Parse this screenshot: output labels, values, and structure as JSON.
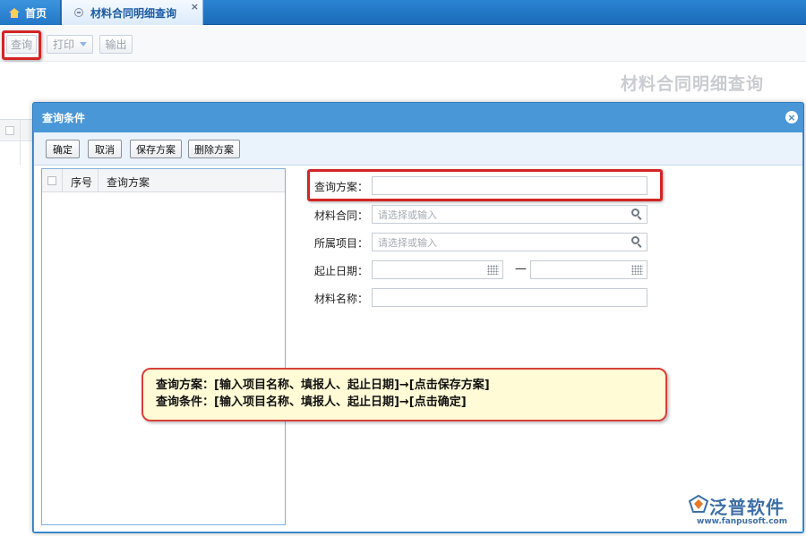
{
  "tabs": {
    "home": {
      "label": "首页",
      "icon": "home-icon"
    },
    "active": {
      "label": "材料合同明细查询",
      "icon": "page-icon",
      "close_glyph": "×"
    }
  },
  "toolbar": {
    "query_label": "查询",
    "print_label": "打印",
    "export_label": "输出"
  },
  "page_title": "材料合同明细查询",
  "dialog": {
    "title": "查询条件",
    "close_glyph": "×",
    "buttons": {
      "confirm": "确定",
      "cancel": "取消",
      "save_plan": "保存方案",
      "delete_plan": "删除方案"
    },
    "list": {
      "columns": [
        "序号",
        "查询方案"
      ],
      "rows": []
    },
    "form": {
      "plan": {
        "label": "查询方案：",
        "value": ""
      },
      "contract": {
        "label": "材料合同：",
        "placeholder": "请选择或输入"
      },
      "project": {
        "label": "所属项目：",
        "placeholder": "请选择或输入"
      },
      "date_range": {
        "label": "起止日期：",
        "start": "",
        "end": "",
        "separator": "—"
      },
      "material_name": {
        "label": "材料名称：",
        "value": ""
      }
    }
  },
  "callout": {
    "line1": "查询方案：[输入项目名称、填报人、起止日期]→[点击保存方案]",
    "line2": "查询条件：[输入项目名称、填报人、起止日期]→[点击确定]"
  },
  "logo": {
    "name": "泛普软件",
    "url": "www.fanpusoft.com"
  },
  "colors": {
    "accent": "#4a97d8",
    "highlight": "#d42424",
    "callout_bg": "#fffbd6"
  }
}
